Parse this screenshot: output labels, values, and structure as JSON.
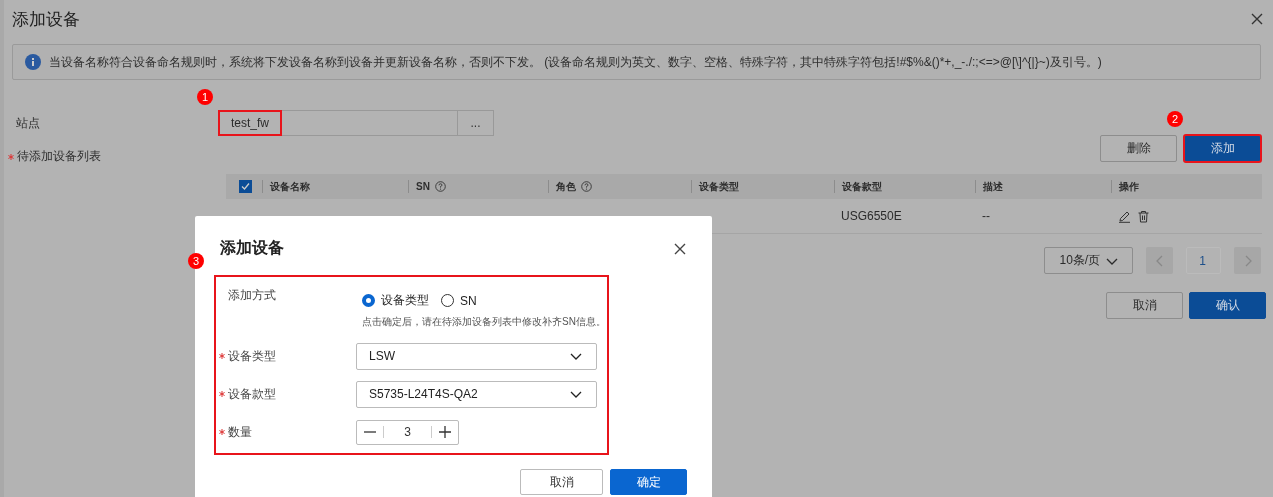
{
  "window": {
    "title": "添加设备"
  },
  "notice": {
    "text": "当设备名称符合设备命名规则时，系统将下发设备名称到设备并更新设备名称，否则不下发。 (设备命名规则为英文、数字、空格、特殊字符，其中特殊字符包括!#$%&()*+,_-./:;<=>@[\\]^{|}~)及引号。)"
  },
  "site": {
    "label": "站点",
    "value": "test_fw",
    "highlighted": true,
    "callout": "1",
    "browse": "..."
  },
  "device_list": {
    "label": "待添加设备列表",
    "required": true
  },
  "toolbar": [
    {
      "label": "删除",
      "kind": "default",
      "highlighted": false
    },
    {
      "label": "添加",
      "kind": "primary",
      "highlighted": true,
      "callout": "2"
    }
  ],
  "table": {
    "select_all_checked": true,
    "columns": [
      {
        "label": "设备名称",
        "help": false
      },
      {
        "label": "SN",
        "help": true
      },
      {
        "label": "角色",
        "help": true
      },
      {
        "label": "设备类型",
        "help": false
      },
      {
        "label": "设备款型",
        "help": false
      },
      {
        "label": "描述",
        "help": false
      },
      {
        "label": "操作",
        "help": false
      }
    ],
    "rows": [
      {
        "device_model": "USG6550E",
        "description": "--"
      }
    ]
  },
  "pagination": {
    "page_size": "10条/页",
    "pages": [
      {
        "label": "1",
        "selected": true
      }
    ]
  },
  "footer": [
    {
      "label": "取消",
      "kind": "default"
    },
    {
      "label": "确认",
      "kind": "primary"
    }
  ],
  "dialog": {
    "title": "添加设备",
    "highlighted": true,
    "callout": "3",
    "fields": [
      {
        "kind": "radio",
        "label": "添加方式",
        "required": false,
        "options": [
          {
            "label": "设备类型",
            "selected": true
          },
          {
            "label": "SN",
            "selected": false
          }
        ],
        "hint": "点击确定后，请在待添加设备列表中修改补齐SN信息。"
      },
      {
        "kind": "select",
        "label": "设备类型",
        "required": true,
        "value": "LSW"
      },
      {
        "kind": "select",
        "label": "设备款型",
        "required": true,
        "value": "S5735-L24T4S-QA2"
      },
      {
        "kind": "stepper",
        "label": "数量",
        "required": true,
        "value": "3"
      }
    ],
    "buttons": [
      {
        "label": "取消",
        "kind": "default"
      },
      {
        "label": "确定",
        "kind": "primary"
      }
    ]
  }
}
